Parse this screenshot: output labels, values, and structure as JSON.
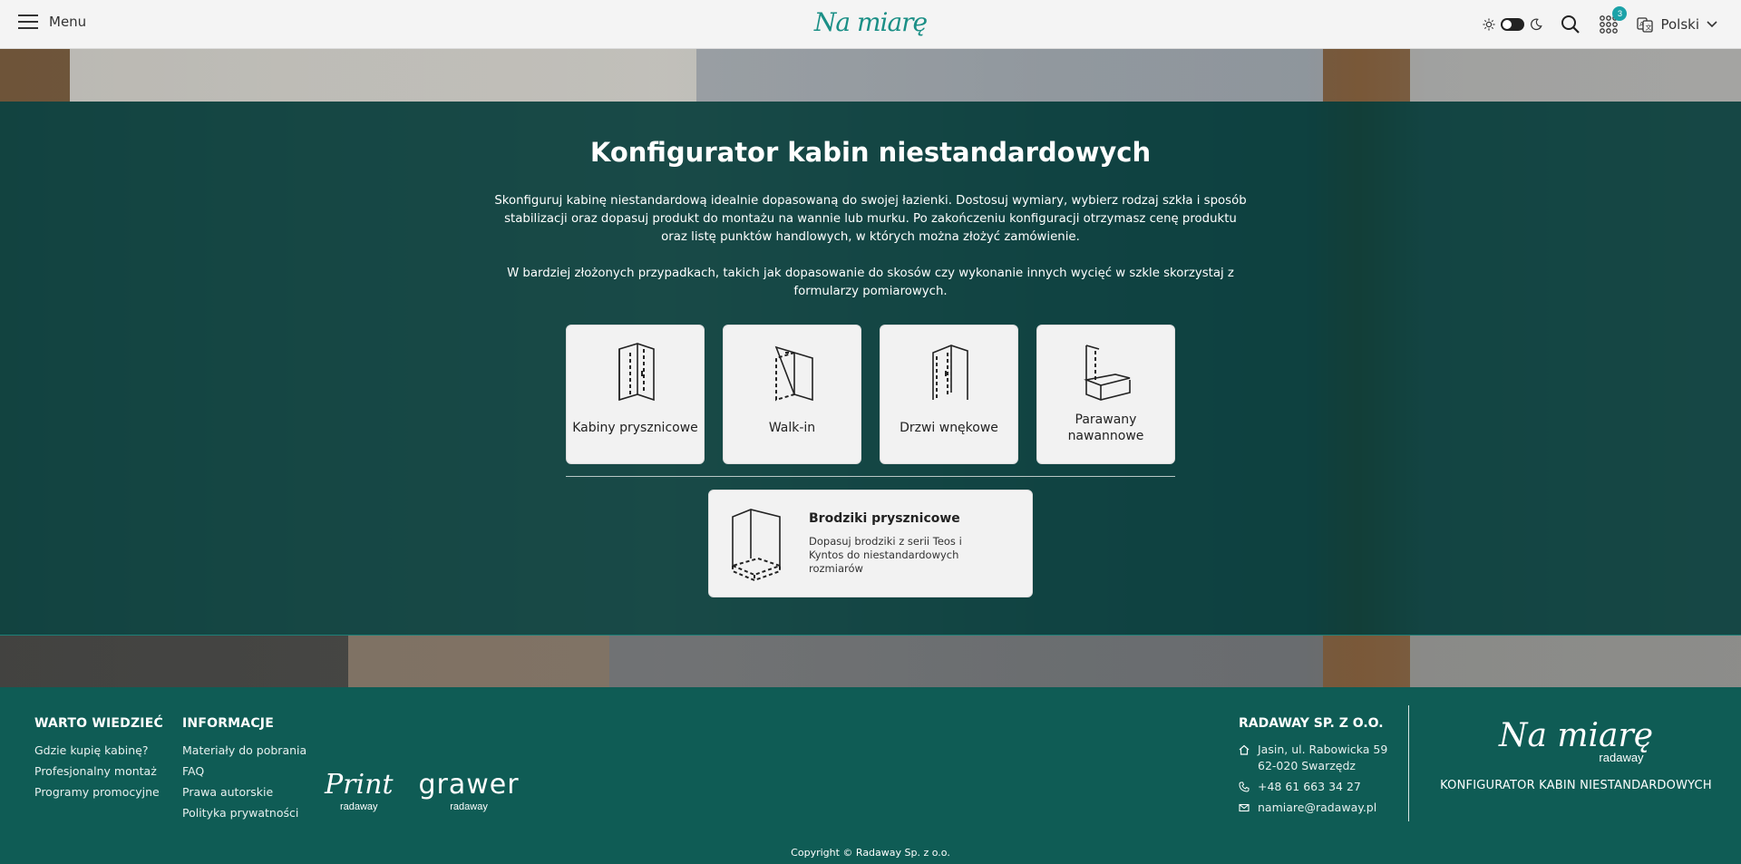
{
  "header": {
    "menu_label": "Menu",
    "logo_text": "Na miarę",
    "cart_count": "3",
    "language": "Polski"
  },
  "hero": {
    "title": "Konfigurator kabin niestandardowych",
    "desc_p1": "Skonfiguruj kabinę niestandardową idealnie dopasowaną do swojej łazienki. Dostosuj wymiary, wybierz rodzaj szkła i sposób stabilizacji oraz dopasuj produkt do montażu na wannie lub murku. Po zakończeniu konfiguracji otrzymasz cenę produktu oraz listę punktów handlowych, w których można złożyć zamówienie.",
    "desc_p2": "W bardziej złożonych przypadkach, takich jak dopasowanie do skosów czy wykonanie innych wycięć w szkle skorzystaj z formularzy pomiarowych.",
    "cards": [
      {
        "label": "Kabiny prysznicowe",
        "icon": "shower-cabin-icon"
      },
      {
        "label": "Walk-in",
        "icon": "walk-in-icon"
      },
      {
        "label": "Drzwi wnękowe",
        "icon": "niche-door-icon"
      },
      {
        "label": "Parawany nawannowe",
        "icon": "bath-screen-icon"
      }
    ],
    "wide_card": {
      "title": "Brodziki prysznicowe",
      "desc": "Dopasuj brodziki z serii Teos i Kyntos do niestandardowych rozmiarów",
      "icon": "shower-tray-icon"
    }
  },
  "footer": {
    "col1": {
      "title": "WARTO WIEDZIEĆ",
      "links": [
        "Gdzie kupię kabinę?",
        "Profesjonalny montaż",
        "Programy promocyjne"
      ]
    },
    "col2": {
      "title": "INFORMACJE",
      "links": [
        "Materiały do pobrania",
        "FAQ",
        "Prawa autorskie",
        "Polityka prywatności"
      ]
    },
    "brands": [
      {
        "main": "Print",
        "sub": "radaway"
      },
      {
        "main": "grawer",
        "sub": "radaway"
      }
    ],
    "company": {
      "name": "RADAWAY SP. Z O.O.",
      "address_line1": "Jasin, ul. Rabowicka 59",
      "address_line2": "62-020 Swarzędz",
      "phone": "+48 61 663 34 27",
      "email": "namiare@radaway.pl"
    },
    "brand_block": {
      "logo": "Na miarę",
      "sub": "radaway",
      "config_label": "KONFIGURATOR KABIN NIESTANDARDOWYCH"
    },
    "copyright": "Copyright © Radaway Sp. z o.o."
  },
  "colors": {
    "accent": "#1b8f86",
    "overlay": "#043c3a",
    "footer_bg": "#0f5c55",
    "card_bg": "#f2f2f2"
  }
}
